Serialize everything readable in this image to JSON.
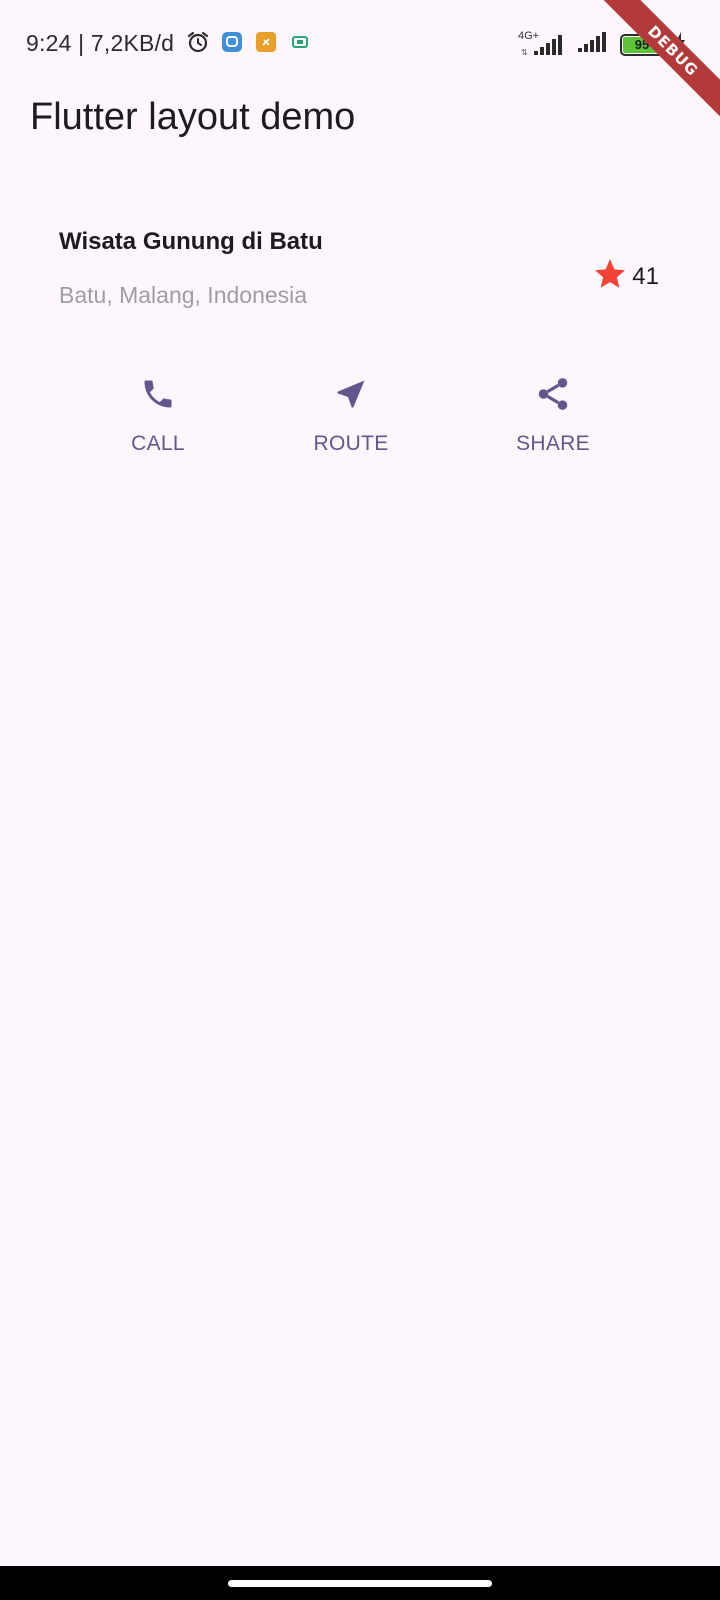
{
  "status_bar": {
    "time": "9:24 | 7,2KB/d",
    "network_type": "4G+",
    "battery_level": "95",
    "icons": [
      "alarm-icon",
      "messenger-app-icon",
      "notification-app-icon",
      "sim-card-icon",
      "signal-icon",
      "signal-icon",
      "battery-icon",
      "charging-icon"
    ]
  },
  "debug_banner": "DEBUG",
  "app_bar": {
    "title": "Flutter layout demo"
  },
  "title_section": {
    "name": "Wisata Gunung di Batu",
    "location": "Batu, Malang, Indonesia",
    "rating_icon": "star-icon",
    "rating_count": "41"
  },
  "actions": [
    {
      "label": "CALL",
      "icon": "phone-icon"
    },
    {
      "label": "ROUTE",
      "icon": "navigation-icon"
    },
    {
      "label": "SHARE",
      "icon": "share-icon"
    }
  ],
  "colors": {
    "background": "#fdf7fd",
    "accent": "#65558f",
    "star": "#f44336",
    "subtitle": "#9e9e9e",
    "debug_banner": "#b33a3a",
    "battery_fill": "#5cc33b"
  }
}
